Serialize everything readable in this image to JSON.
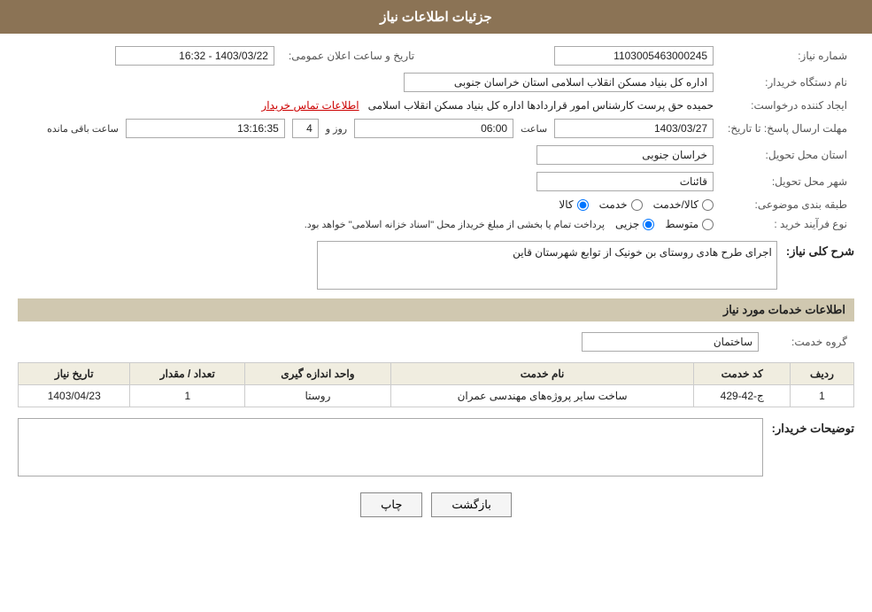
{
  "header": {
    "title": "جزئیات اطلاعات نیاز"
  },
  "fields": {
    "need_number_label": "شماره نیاز:",
    "need_number_value": "1103005463000245",
    "buyer_org_label": "نام دستگاه خریدار:",
    "buyer_org_value": "اداره کل بنیاد مسکن انقلاب اسلامی استان خراسان جنوبی",
    "creator_label": "ایجاد کننده درخواست:",
    "creator_value": "حمیده حق پرست کارشناس امور قراردادها اداره کل بنیاد مسکن انقلاب اسلامی",
    "contact_link": "اطلاعات تماس خریدار",
    "announce_date_label": "تاریخ و ساعت اعلان عمومی:",
    "announce_date_value": "1403/03/22 - 16:32",
    "send_deadline_label": "مهلت ارسال پاسخ: تا تاریخ:",
    "deadline_date": "1403/03/27",
    "deadline_time_label": "ساعت",
    "deadline_time": "06:00",
    "deadline_days_label": "روز و",
    "deadline_days": "4",
    "deadline_remaining_label": "ساعت باقی مانده",
    "deadline_remaining": "13:16:35",
    "province_label": "استان محل تحویل:",
    "province_value": "خراسان جنوبی",
    "city_label": "شهر محل تحویل:",
    "city_value": "قائنات",
    "category_label": "طبقه بندی موضوعی:",
    "category_kala": "کالا",
    "category_khedmat": "خدمت",
    "category_kala_khedmat": "کالا/خدمت",
    "process_label": "نوع فرآیند خرید :",
    "process_jozi": "جزیی",
    "process_motavaset": "متوسط",
    "process_note": "پرداخت تمام یا بخشی از مبلغ خریداز محل \"اسناد خزانه اسلامی\" خواهد بود.",
    "need_description_label": "شرح کلی نیاز:",
    "need_description_value": "اجرای طرح هادی روستای بن خونیک از توابع شهرستان قاین",
    "service_info_title": "اطلاعات خدمات مورد نیاز",
    "service_group_label": "گروه خدمت:",
    "service_group_value": "ساختمان",
    "table_headers": {
      "row_num": "ردیف",
      "service_code": "کد خدمت",
      "service_name": "نام خدمت",
      "unit": "واحد اندازه گیری",
      "quantity": "تعداد / مقدار",
      "date": "تاریخ نیاز"
    },
    "table_rows": [
      {
        "row_num": "1",
        "service_code": "ج-42-429",
        "service_name": "ساخت سایر پروژه‌های مهندسی عمران",
        "unit": "روستا",
        "quantity": "1",
        "date": "1403/04/23"
      }
    ],
    "buyer_description_label": "توضیحات خریدار:",
    "buyer_description_value": "",
    "buttons": {
      "print": "چاپ",
      "back": "بازگشت"
    }
  }
}
